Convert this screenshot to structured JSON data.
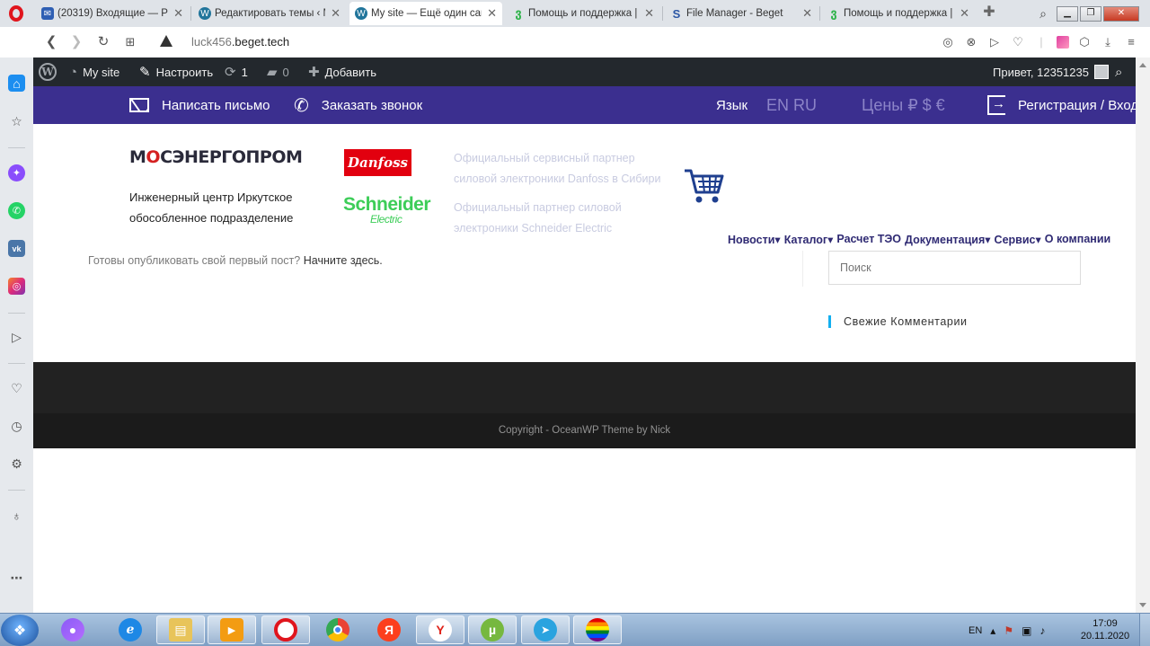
{
  "browser": {
    "tabs": [
      {
        "label": "(20319) Входящие — Ра",
        "icon": "mail-icon",
        "color": "#2f5fb3"
      },
      {
        "label": "Редактировать темы ‹ М",
        "icon": "wordpress-icon",
        "color": "#21759b"
      },
      {
        "label": "My site — Ещё один сай",
        "icon": "wordpress-icon",
        "color": "#21759b",
        "active": true
      },
      {
        "label": "Помощь и поддержка |",
        "icon": "beget-icon",
        "color": "#2fb34a"
      },
      {
        "label": "File Manager - Beget",
        "icon": "beget-icon",
        "color": "#2c57a5"
      },
      {
        "label": "Помощь и поддержка |",
        "icon": "beget-icon",
        "color": "#2fb34a"
      }
    ],
    "url_host": "luck456",
    "url_domain": ".beget.tech"
  },
  "wp_admin": {
    "site": "My site",
    "customize": "Настроить",
    "updates": "1",
    "comments": "0",
    "add_new": "Добавить",
    "greeting": "Привет, 12351235"
  },
  "topbar": {
    "write_letter": "Написать письмо",
    "order_call": "Заказать звонок",
    "lang_label": "Язык",
    "lang_options": "EN RU",
    "prices_label": "Цены ₽ $ €",
    "login": "Регистрация / Вход"
  },
  "header": {
    "logo_a": "М",
    "logo_o": "О",
    "logo_rest": "СЭНЕРГОПРОМ",
    "subtitle": "Инженерный центр Иркутское обособленное подразделение",
    "danfoss": "Danfoss",
    "schneider": "Schneider",
    "schneider_sub": "Electric",
    "partner_danfoss": "Официальный сервисный партнер силовой электроники Danfoss в Сибири",
    "partner_schneider": "Официальный партнер силовой электроники Schneider Electric"
  },
  "nav": {
    "items": [
      "Новости▾",
      "Каталог▾",
      "Расчет ТЭО",
      "Документация▾",
      "Сервис▾",
      "О компании"
    ]
  },
  "content": {
    "ready_text": "Готовы опубликовать свой первый пост?",
    "start_link": "Начните здесь."
  },
  "sidebar": {
    "search_placeholder": "Поиск",
    "recent_comments": "Свежие Комментарии"
  },
  "footer": {
    "copyright": "Copyright - OceanWP Theme by Nick"
  },
  "taskbar": {
    "lang": "EN",
    "time": "17:09",
    "date": "20.11.2020"
  },
  "colors": {
    "brand_purple": "#3b2f8f",
    "nav_text": "#2f2a73",
    "accent_blue": "#13aff0",
    "wp_admin_bg": "#23282d"
  }
}
